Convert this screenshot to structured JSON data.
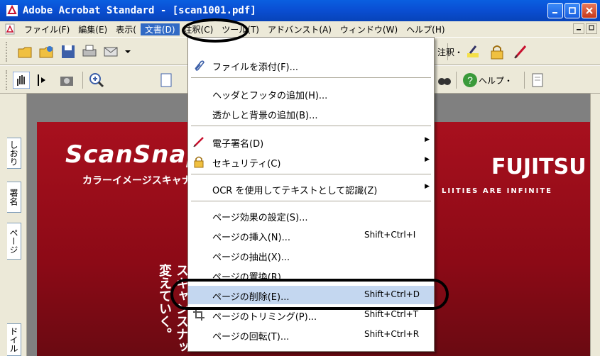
{
  "window": {
    "title": "Adobe Acrobat Standard - [scan1001.pdf]",
    "controls": [
      "minimize-icon",
      "restore-icon",
      "close-icon"
    ]
  },
  "menubar": {
    "items": [
      {
        "label": "ファイル(F)"
      },
      {
        "label": "編集(E)"
      },
      {
        "label": "表示("
      },
      {
        "label": "文書(D)"
      },
      {
        "label": "注釈(C)"
      },
      {
        "label": "ツール(T)"
      },
      {
        "label": "アドバンスト(A)"
      },
      {
        "label": "ウィンドウ(W)"
      },
      {
        "label": "ヘルプ(H)"
      }
    ]
  },
  "toolbar": {
    "row1_right_label": "注釈・",
    "help_label": "ヘルプ・"
  },
  "side_tabs": [
    "しおり",
    "署名",
    "ページ",
    "ドイル"
  ],
  "document": {
    "logo": "ScanSnap",
    "subtitle": "カラーイメージスキャナ",
    "brand": "FUJITSU",
    "tagline": "LIITIES ARE INFINITE",
    "vertical_col1": "変えていく。",
    "vertical_col2": "スキャンスナッ"
  },
  "dropdown": {
    "items": [
      {
        "label": "ファイルを添付(F)...",
        "shortcut": "",
        "icon": "paperclip-icon",
        "submenu": false
      },
      {
        "label": "ヘッダとフッタの追加(H)...",
        "shortcut": "",
        "icon": "",
        "submenu": false
      },
      {
        "label": "透かしと背景の追加(B)...",
        "shortcut": "",
        "icon": "",
        "submenu": false
      },
      {
        "label": "電子署名(D)",
        "shortcut": "",
        "icon": "pen-icon",
        "submenu": true
      },
      {
        "label": "セキュリティ(C)",
        "shortcut": "",
        "icon": "lock-icon",
        "submenu": true
      },
      {
        "label": "OCR を使用してテキストとして認識(Z)",
        "shortcut": "",
        "icon": "",
        "submenu": true
      },
      {
        "label": "ページ効果の設定(S)...",
        "shortcut": "",
        "icon": "",
        "submenu": false
      },
      {
        "label": "ページの挿入(N)...",
        "shortcut": "Shift+Ctrl+I",
        "icon": "",
        "submenu": false
      },
      {
        "label": "ページの抽出(X)...",
        "shortcut": "",
        "icon": "",
        "submenu": false
      },
      {
        "label": "ページの置換(R)...",
        "shortcut": "",
        "icon": "",
        "submenu": false
      },
      {
        "label": "ページの削除(E)...",
        "shortcut": "Shift+Ctrl+D",
        "icon": "",
        "submenu": false
      },
      {
        "label": "ページのトリミング(P)...",
        "shortcut": "Shift+Ctrl+T",
        "icon": "crop-icon",
        "submenu": false
      },
      {
        "label": "ページの回転(T)...",
        "shortcut": "Shift+Ctrl+R",
        "icon": "",
        "submenu": false
      }
    ]
  },
  "colors": {
    "titlebar": "#0a4fd4",
    "menu_highlight": "#316ac5",
    "item_highlight": "#c4d7f0",
    "page_red": "#a8101e"
  }
}
